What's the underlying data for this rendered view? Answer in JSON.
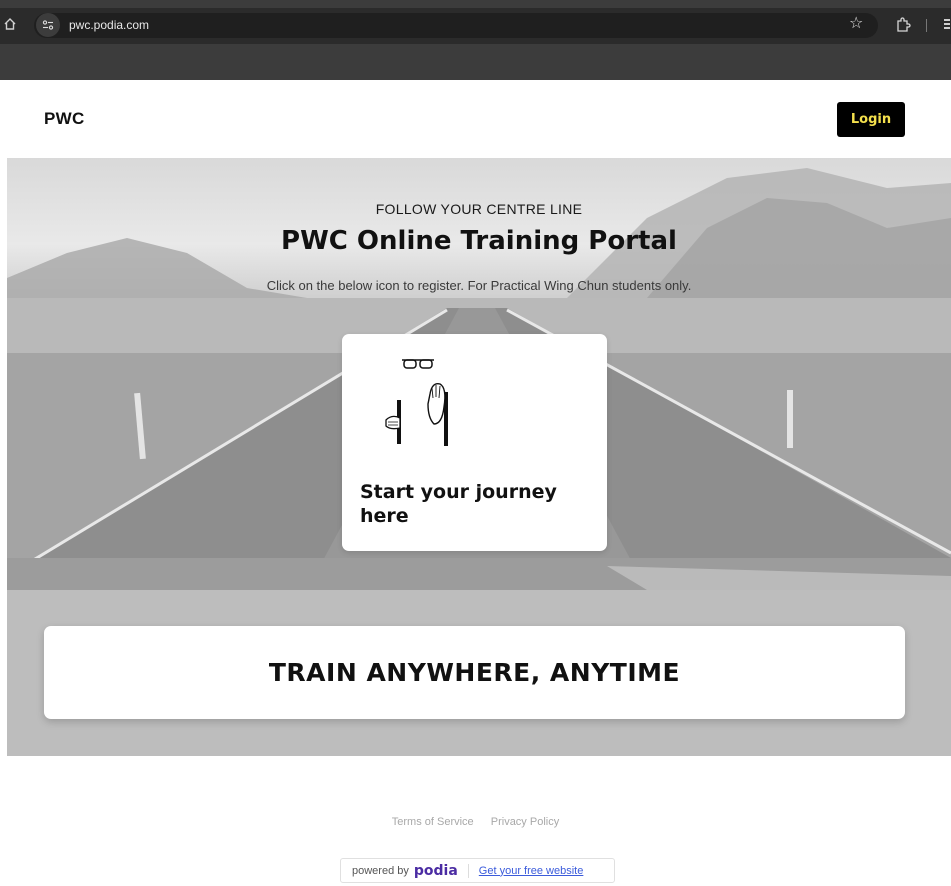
{
  "browser": {
    "url": "pwc.podia.com",
    "icons": [
      "home-icon",
      "site-info-icon",
      "bookmark-star-icon",
      "extensions-icon",
      "menu-icon"
    ]
  },
  "header": {
    "brand": "PWC",
    "login_label": "Login"
  },
  "hero": {
    "eyebrow": "FOLLOW YOUR CENTRE LINE",
    "title": "PWC Online Training Portal",
    "subtitle": "Click on the below icon to register. For Practical Wing Chun students only.",
    "card": {
      "title": "Start your journey here",
      "art": "glasses-and-hands-illustration"
    }
  },
  "tagline": "TRAIN ANYWHERE, ANYTIME",
  "footer": {
    "links": [
      "Terms of Service",
      "Privacy Policy"
    ],
    "powered_by": "powered by",
    "logo_text": "podia",
    "free_website": "Get your free website"
  },
  "colors": {
    "login_bg": "#000000",
    "login_text": "#f4e04d",
    "podia_logo": "#4b2ca3"
  }
}
